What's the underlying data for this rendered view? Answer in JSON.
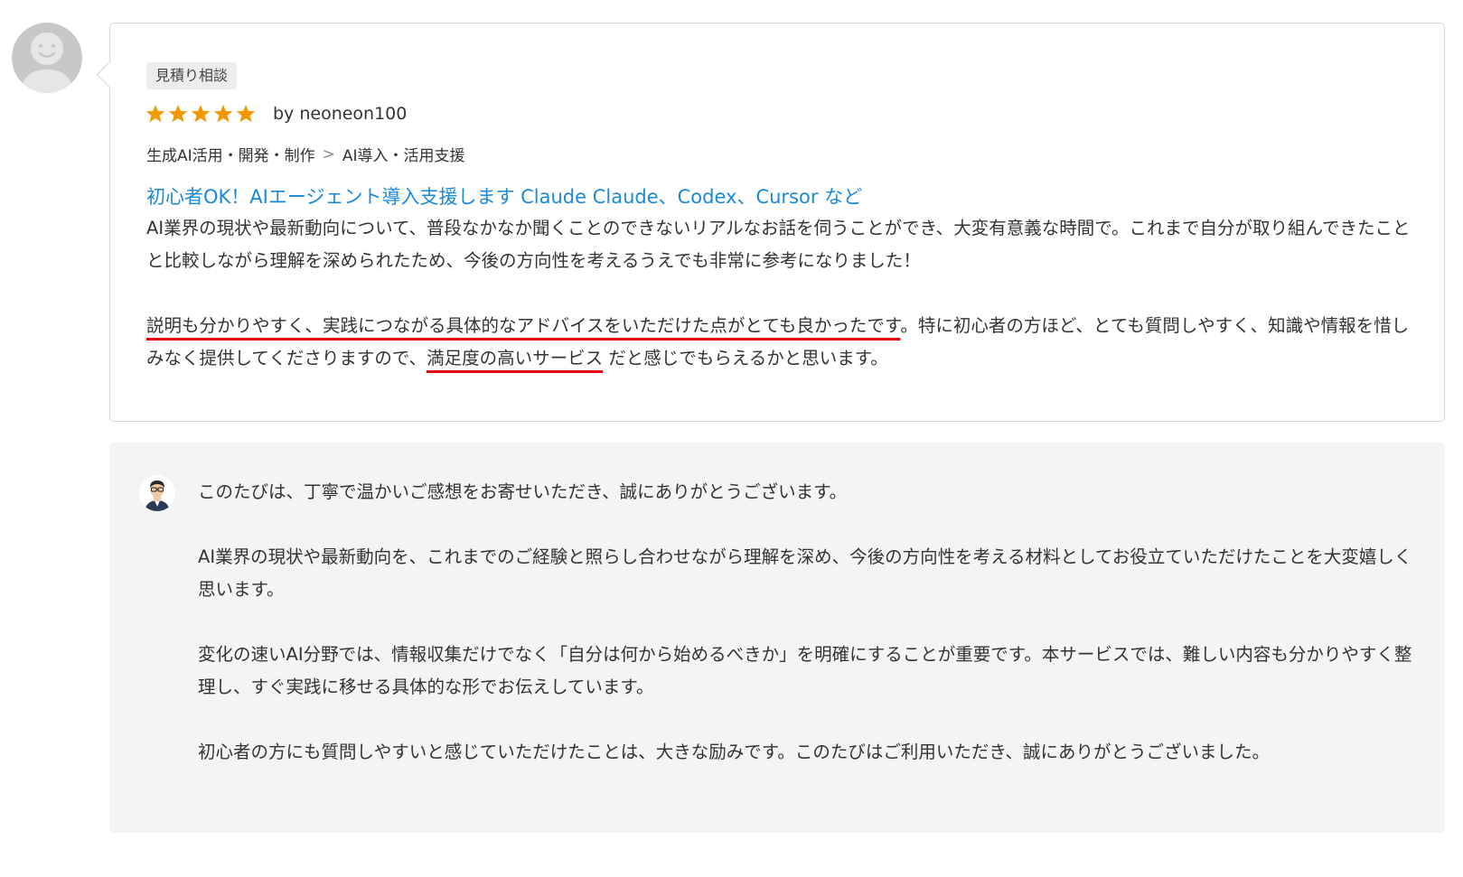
{
  "review": {
    "tag": "見積り相談",
    "rating": 5,
    "byline": "by neoneon100",
    "category": {
      "parent": "生成AI活用・開発・制作",
      "separator": ">",
      "child": "AI導入・活用支援"
    },
    "service_title": "初心者OK！AIエージェント導入支援します Claude Claude、Codex、Cursor など",
    "paragraph1": "AI業界の現状や最新動向について、普段なかなか聞くことのできないリアルなお話を伺うことができ、大変有意義な時間で。これまで自分が取り組んできたことと比較しながら理解を深められたため、今後の方向性を考えるうえでも非常に参考になりました！",
    "paragraph2": {
      "highlight1": "説明も分かりやすく、実践につながる具体的なアドバイスをいただけた点がとても良かったです",
      "text1": "。特に初心者の方ほど、とても質問しやすく、知識や情報を惜しみなく提供してくださりますので、",
      "highlight2": "満足度の高いサービス",
      "text2": " だと感じでもらえるかと思います。"
    }
  },
  "reply": {
    "paragraphs": [
      "このたびは、丁寧で温かいご感想をお寄せいただき、誠にありがとうございます。",
      "AI業界の現状や最新動向を、これまでのご経験と照らし合わせながら理解を深め、今後の方向性を考える材料としてお役立ていただけたことを大変嬉しく思います。",
      "変化の速いAI分野では、情報収集だけでなく「自分は何から始めるべきか」を明確にすることが重要です。本サービスでは、難しい内容も分かりやすく整理し、すぐ実践に移せる具体的な形でお伝えしています。",
      "初心者の方にも質問しやすいと感じていただけたことは、大きな励みです。このたびはご利用いただき、誠にありがとうございました。"
    ]
  },
  "colors": {
    "link": "#1a8ad8",
    "star": "#f39800",
    "underline": "#e60012",
    "reply_bg": "#f3f4f6"
  },
  "icons": {
    "reviewer_avatar": "default-user-avatar",
    "seller_avatar": "seller-portrait",
    "star": "star-icon"
  }
}
